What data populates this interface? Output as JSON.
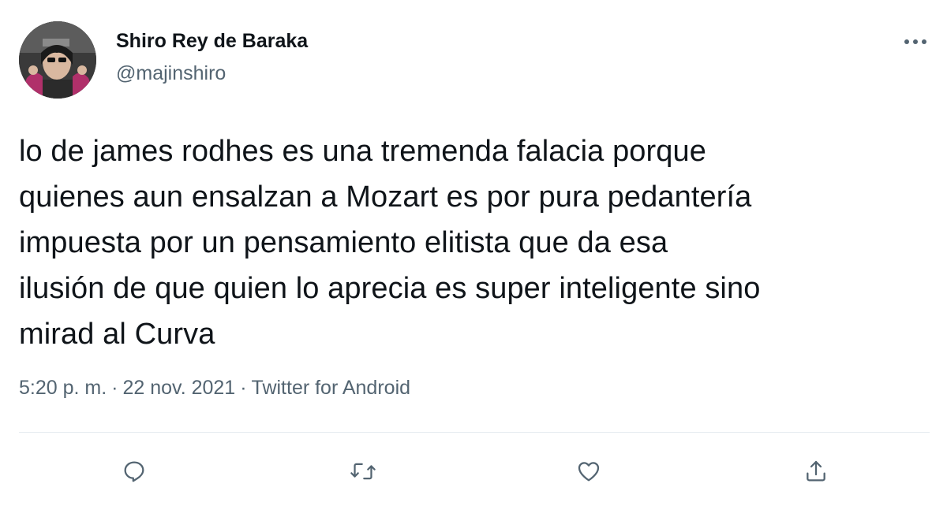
{
  "author": {
    "name": "Shiro Rey de Baraka",
    "handle": "@majinshiro",
    "avatar_icon": "avatar-photo"
  },
  "tweet": {
    "text": "lo de james rodhes es una tremenda falacia porque\nquienes aun ensalzan a Mozart es por pura pedantería\nimpuesta por un pensamiento elitista que da esa\nilusión de que quien lo aprecia es super inteligente sino\nmirad al Curva",
    "time": "5:20 p. m.",
    "date": "22 nov. 2021",
    "source": "Twitter for Android",
    "separator": "·"
  },
  "actions": {
    "reply_icon": "reply-icon",
    "retweet_icon": "retweet-icon",
    "like_icon": "heart-icon",
    "share_icon": "share-icon"
  },
  "colors": {
    "text_primary": "#0f1419",
    "text_secondary": "#536471",
    "divider": "#e6ecf0"
  }
}
